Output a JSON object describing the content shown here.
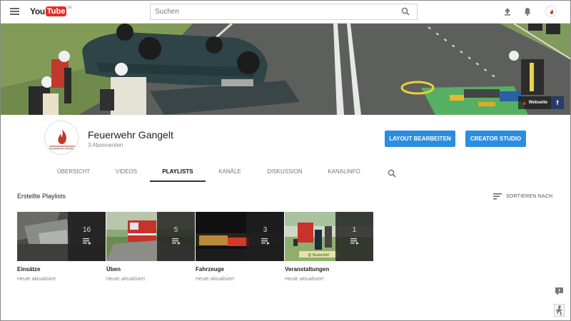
{
  "topbar": {
    "logo_text": "You",
    "logo_tube": "Tube",
    "logo_region": "DE",
    "search_placeholder": "Suchen",
    "icons": [
      "menu-icon",
      "search-icon",
      "upload-icon",
      "bell-icon",
      "avatar"
    ]
  },
  "banner": {
    "link_label": "Webseite",
    "social": "f"
  },
  "channel": {
    "name": "Feuerwehr Gangelt",
    "subscribers": "3 Abonnenten",
    "layout_button": "LAYOUT BEARBEITEN",
    "studio_button": "CREATOR STUDIO",
    "avatar_logo_text": "FEUERWEHR GANGELT"
  },
  "tabs": [
    {
      "label": "ÜBERSICHT",
      "active": false
    },
    {
      "label": "VIDEOS",
      "active": false
    },
    {
      "label": "PLAYLISTS",
      "active": true
    },
    {
      "label": "KANÄLE",
      "active": false
    },
    {
      "label": "DISKUSSION",
      "active": false
    },
    {
      "label": "KANALINFO",
      "active": false
    }
  ],
  "section": {
    "title": "Erstellte Playlists",
    "sort_label": "SORTIEREN NACH"
  },
  "playlists": [
    {
      "title": "Einsätze",
      "count": "16",
      "updated": "Heute aktualisiert"
    },
    {
      "title": "Üben",
      "count": "5",
      "updated": "Heute aktualisiert"
    },
    {
      "title": "Fahrzeuge",
      "count": "3",
      "updated": "Heute aktualisiert"
    },
    {
      "title": "Veranstaltungen",
      "count": "1",
      "updated": "Heute aktualisiert"
    }
  ],
  "colors": {
    "accent_blue": "#2b8de0",
    "youtube_red": "#e52d27",
    "banner_grass": "#56b063"
  }
}
